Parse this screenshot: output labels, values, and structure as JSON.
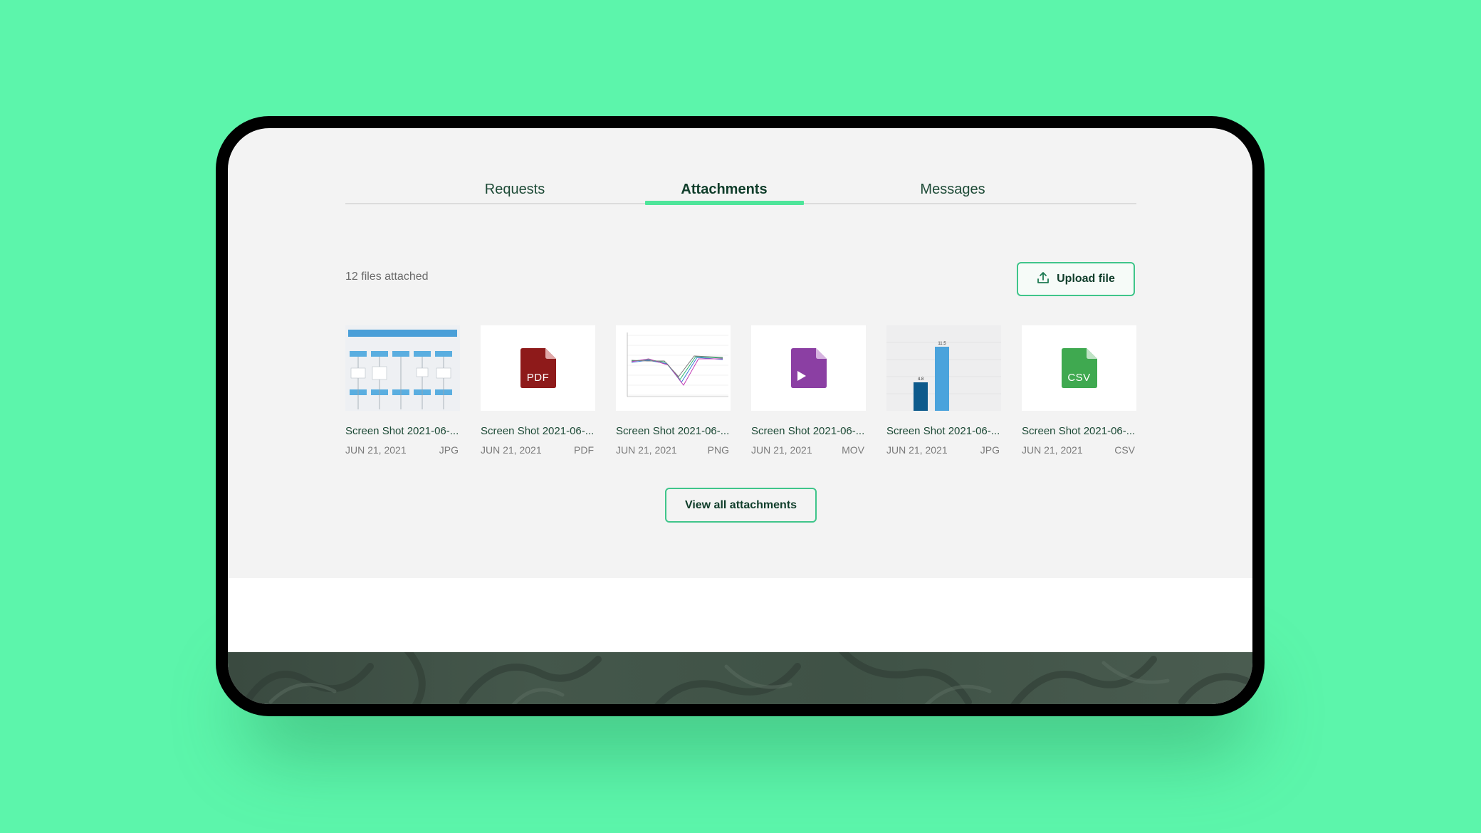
{
  "tabs": [
    {
      "label": "Requests",
      "active": false
    },
    {
      "label": "Attachments",
      "active": true
    },
    {
      "label": "Messages",
      "active": false
    }
  ],
  "attachments_summary": "12 files attached",
  "upload_button": {
    "label": "Upload file",
    "icon": "upload-icon"
  },
  "files": [
    {
      "name": "Screen Shot 2021-06-...",
      "date": "JUN 21, 2021",
      "type": "JPG",
      "thumbnail": "flowchart-screenshot"
    },
    {
      "name": "Screen Shot 2021-06-...",
      "date": "JUN 21, 2021",
      "type": "PDF",
      "thumbnail": "pdf-file-icon",
      "icon_text": "PDF",
      "icon_color": "#8e1a1a"
    },
    {
      "name": "Screen Shot 2021-06-...",
      "date": "JUN 21, 2021",
      "type": "PNG",
      "thumbnail": "line-chart-screenshot"
    },
    {
      "name": "Screen Shot 2021-06-...",
      "date": "JUN 21, 2021",
      "type": "MOV",
      "thumbnail": "video-file-icon",
      "icon_color": "#8b3fa3"
    },
    {
      "name": "Screen Shot 2021-06-...",
      "date": "JUN 21, 2021",
      "type": "JPG",
      "thumbnail": "bar-chart-screenshot",
      "bar_labels": [
        "4.8",
        "11.5"
      ]
    },
    {
      "name": "Screen Shot 2021-06-...",
      "date": "JUN 21, 2021",
      "type": "CSV",
      "thumbnail": "csv-file-icon",
      "icon_text": "CSV",
      "icon_color": "#3fa950"
    }
  ],
  "view_all_button": "View all attachments",
  "colors": {
    "background": "#5cf5ab",
    "accent": "#4ee59a",
    "text_dark": "#0f3d2a"
  }
}
